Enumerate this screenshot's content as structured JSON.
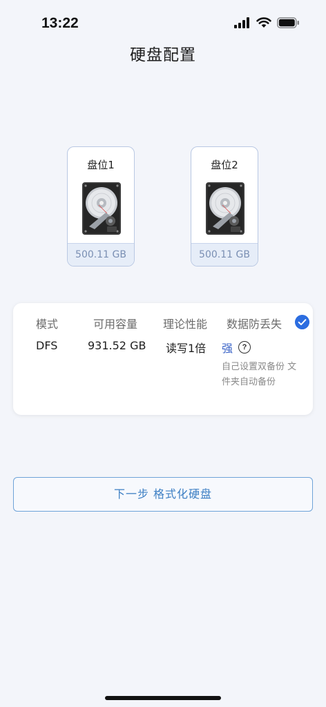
{
  "status_bar": {
    "time": "13:22",
    "icons": [
      "cellular-signal-icon",
      "wifi-icon",
      "battery-icon"
    ]
  },
  "header": {
    "title": "硬盘配置"
  },
  "disks": [
    {
      "label": "盘位1",
      "size": "500.11 GB",
      "icon": "hard-disk-icon"
    },
    {
      "label": "盘位2",
      "size": "500.11 GB",
      "icon": "hard-disk-icon"
    }
  ],
  "mode_card": {
    "headers": {
      "mode": "模式",
      "capacity": "可用容量",
      "performance": "理论性能",
      "protection": "数据防丢失"
    },
    "values": {
      "mode": "DFS",
      "capacity": "931.52 GB",
      "performance": "读写1倍",
      "protection": "强"
    },
    "description": "自己设置双备份 文件夹自动备份",
    "selected": true,
    "icons": [
      "help-icon",
      "check-icon"
    ]
  },
  "actions": {
    "next_label": "下一步 格式化硬盘"
  },
  "colors": {
    "background": "#f3f5fa",
    "accent": "#2c6de0",
    "button_border": "#6ea3d8",
    "button_text": "#3d7fc4",
    "disk_size_text": "#7a8fb3",
    "strong_text": "#3a63c7"
  }
}
